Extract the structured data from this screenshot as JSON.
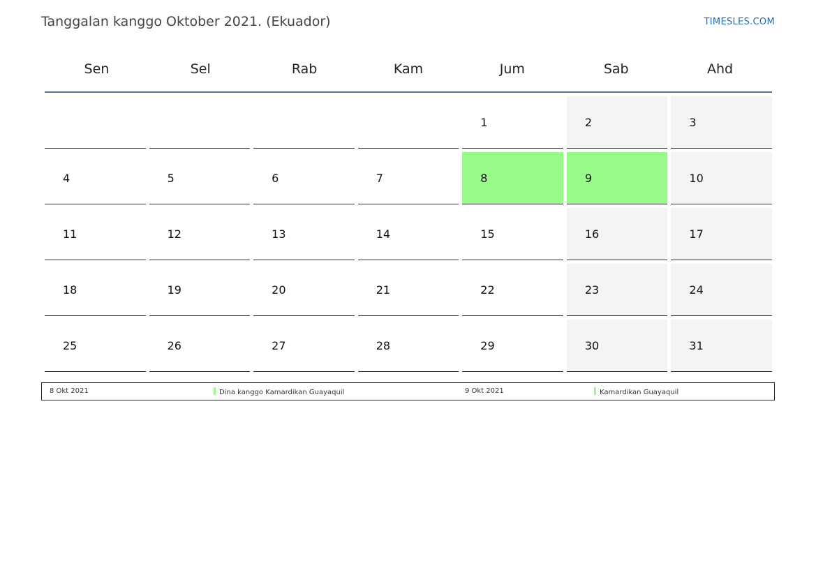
{
  "header": {
    "title": "Tanggalan kanggo Oktober 2021. (Ekuador)",
    "site": "TIMESLES.COM"
  },
  "colors": {
    "holiday": "#98fb89",
    "weekend": "#f4f4f4",
    "header_rule": "#5b7391",
    "link": "#2b6cb0"
  },
  "calendar": {
    "weekdays": [
      "Sen",
      "Sel",
      "Rab",
      "Kam",
      "Jum",
      "Sab",
      "Ahd"
    ],
    "weeks": [
      [
        "",
        "",
        "",
        "",
        "1",
        "2",
        "3"
      ],
      [
        "4",
        "5",
        "6",
        "7",
        "8",
        "9",
        "10"
      ],
      [
        "11",
        "12",
        "13",
        "14",
        "15",
        "16",
        "17"
      ],
      [
        "18",
        "19",
        "20",
        "21",
        "22",
        "23",
        "24"
      ],
      [
        "25",
        "26",
        "27",
        "28",
        "29",
        "30",
        "31"
      ]
    ],
    "holidays": [
      "8",
      "9"
    ]
  },
  "legend": [
    {
      "date": "8 Okt 2021",
      "name": "Dina kanggo Kamardikan Guayaquil"
    },
    {
      "date": "9 Okt 2021",
      "name": "Kamardikan Guayaquil"
    }
  ]
}
